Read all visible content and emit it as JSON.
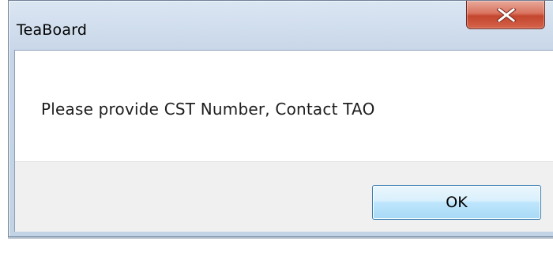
{
  "window": {
    "title": "TeaBoard",
    "close_icon": "close-icon"
  },
  "dialog": {
    "message": "Please provide CST Number, Contact TAO",
    "ok_label": "OK"
  },
  "colors": {
    "close_button": "#c4452d",
    "ok_button_border": "#3c7fb1",
    "frame": "#cfdcec"
  }
}
